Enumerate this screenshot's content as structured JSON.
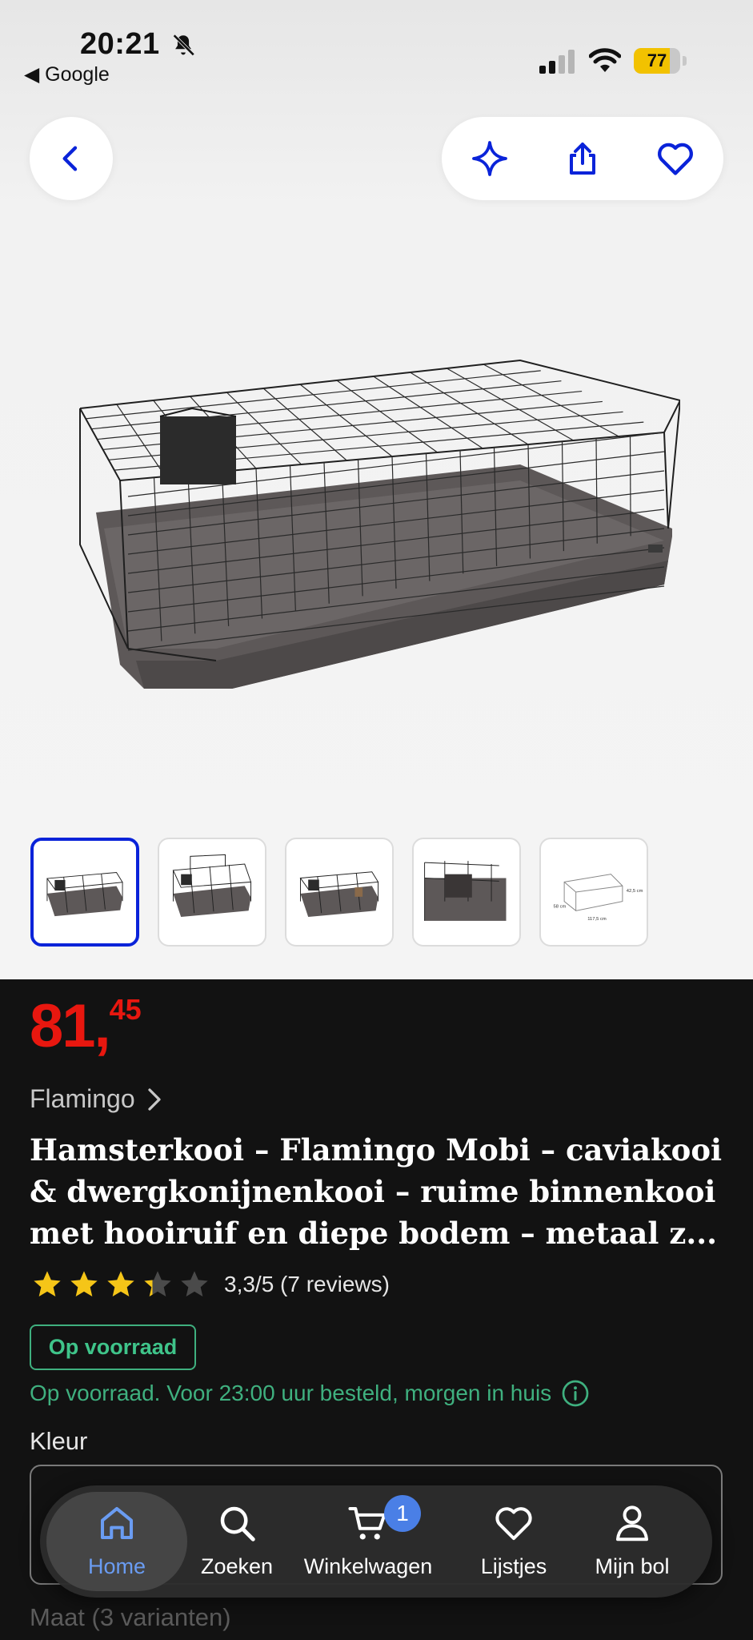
{
  "status_bar": {
    "time": "20:21",
    "back_app": "◀ Google",
    "battery": "77"
  },
  "product": {
    "price_int": "81,",
    "price_dec": "45",
    "brand": "Flamingo",
    "title": "Hamsterkooi – Flamingo Mobi – caviakooi & dwergkonijnenkooi – ruime binnenkooi met hooiruif en diepe bodem – metaal z...",
    "rating": 3.3,
    "rating_text": "3,3/5 (7 reviews)",
    "stock_badge": "Op voorraad",
    "delivery": "Op voorraad. Voor 23:00 uur besteld, morgen in huis",
    "color_label": "Kleur",
    "size_label": "Maat (3 varianten)"
  },
  "thumbnails": [
    {
      "name": "thumb-1",
      "active": true
    },
    {
      "name": "thumb-2",
      "active": false
    },
    {
      "name": "thumb-3",
      "active": false
    },
    {
      "name": "thumb-4",
      "active": false
    },
    {
      "name": "thumb-5",
      "active": false
    }
  ],
  "thumb_dimension_labels": [
    "58 cm",
    "42,5 cm",
    "117,5 cm"
  ],
  "bottom_nav": {
    "home": "Home",
    "search": "Zoeken",
    "cart": "Winkelwagen",
    "cart_count": "1",
    "lists": "Lijstjes",
    "account": "Mijn bol"
  },
  "icons": {
    "back": "chevron-left-icon",
    "sparkle": "sparkle-icon",
    "share": "share-icon",
    "favorite": "heart-icon"
  },
  "colors": {
    "accent_blue": "#0a23d9",
    "price_red": "#e8170f",
    "stock_green": "#3fb07f",
    "star_yellow": "#f5c518",
    "nav_active": "#6a9cf2"
  }
}
